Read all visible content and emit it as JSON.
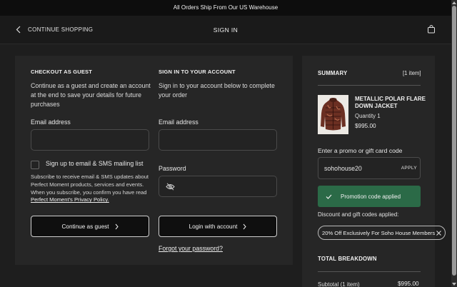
{
  "banner": {
    "text": "All Orders Ship From Our US Warehouse"
  },
  "header": {
    "back_label": "CONTINUE SHOPPING",
    "title": "SIGN IN"
  },
  "guest": {
    "heading": "CHECKOUT AS GUEST",
    "description": "Continue as a guest and create an account at the end to save your details for future purchases",
    "email_label": "Email address",
    "email_value": "",
    "signup_label": "Sign up to email & SMS mailing list",
    "signup_note": "Subscribe to receive email & SMS updates about Perfect Moment products, services and events. When you subscribe, you confirm you have read ",
    "privacy_link": "Perfect Moment's Privacy Policy.",
    "continue_label": "Continue as guest"
  },
  "account": {
    "heading": "SIGN IN TO YOUR ACCOUNT",
    "description": "Sign in to your account below to complete your order",
    "email_label": "Email address",
    "email_value": "",
    "password_label": "Password",
    "password_value": "",
    "login_label": "Login with account",
    "forgot_label": "Forgot your password?"
  },
  "summary": {
    "heading": "SUMMARY",
    "item_count": "[1 item]",
    "product": {
      "name": "METALLIC POLAR FLARE DOWN JACKET",
      "quantity": "Quantity 1",
      "price": "$995.00"
    },
    "promo_label": "Enter a promo or gift card code",
    "promo_value": "sohohouse20",
    "apply_label": "APPLY",
    "applied_message": "Promotion code applied",
    "discount_label": "Discount and gift codes applied:",
    "discount_chip": "20% Off Exclusively For Soho House Members",
    "breakdown_heading": "TOTAL BREAKDOWN",
    "subtotal_label": "Subtotal (1 item)",
    "subtotal_value": "$995.00"
  },
  "colors": {
    "background": "#1e1e1e",
    "panel": "#262626",
    "success": "#2b6a47",
    "banner": "#0d0d0d"
  },
  "icons": [
    "chevron-left-icon",
    "shopping-bag-icon",
    "eye-off-icon",
    "chevron-right-icon",
    "check-icon",
    "close-icon"
  ]
}
